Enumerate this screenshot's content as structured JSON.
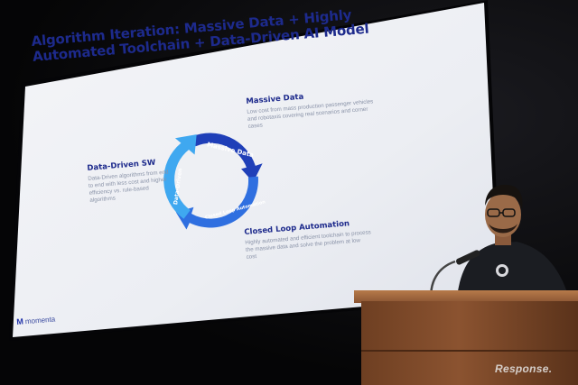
{
  "slide": {
    "title": "Algorithm Iteration: Massive Data + Highly Automated Toolchain + Data-Driven AI Model",
    "massive_data": {
      "heading": "Massive Data",
      "body": "Low cost from mass production passenger vehicles and robotaxis covering real scenarios and corner cases"
    },
    "data_driven_sw": {
      "heading": "Data-Driven SW",
      "body": "Data-Driven algorithms from end to end with less cost and higher efficiency vs. rule-based algorithms"
    },
    "closed_loop": {
      "heading": "Closed Loop Automation",
      "body": "Highly automated and efficient toolchain to process the massive data and solve the problem at low cost"
    },
    "cycle": {
      "segment_1": "Massive Data",
      "segment_2": "Closed Loop Automation",
      "segment_3": "Data-Driven"
    },
    "logo_text": "momenta"
  },
  "watermark": "Response.",
  "colors": {
    "title_blue": "#1d2a8c",
    "cycle_dark": "#1f3fb8",
    "cycle_mid": "#2f6fe0",
    "cycle_light": "#3fa8f0",
    "podium_wood": "#8b5330"
  }
}
